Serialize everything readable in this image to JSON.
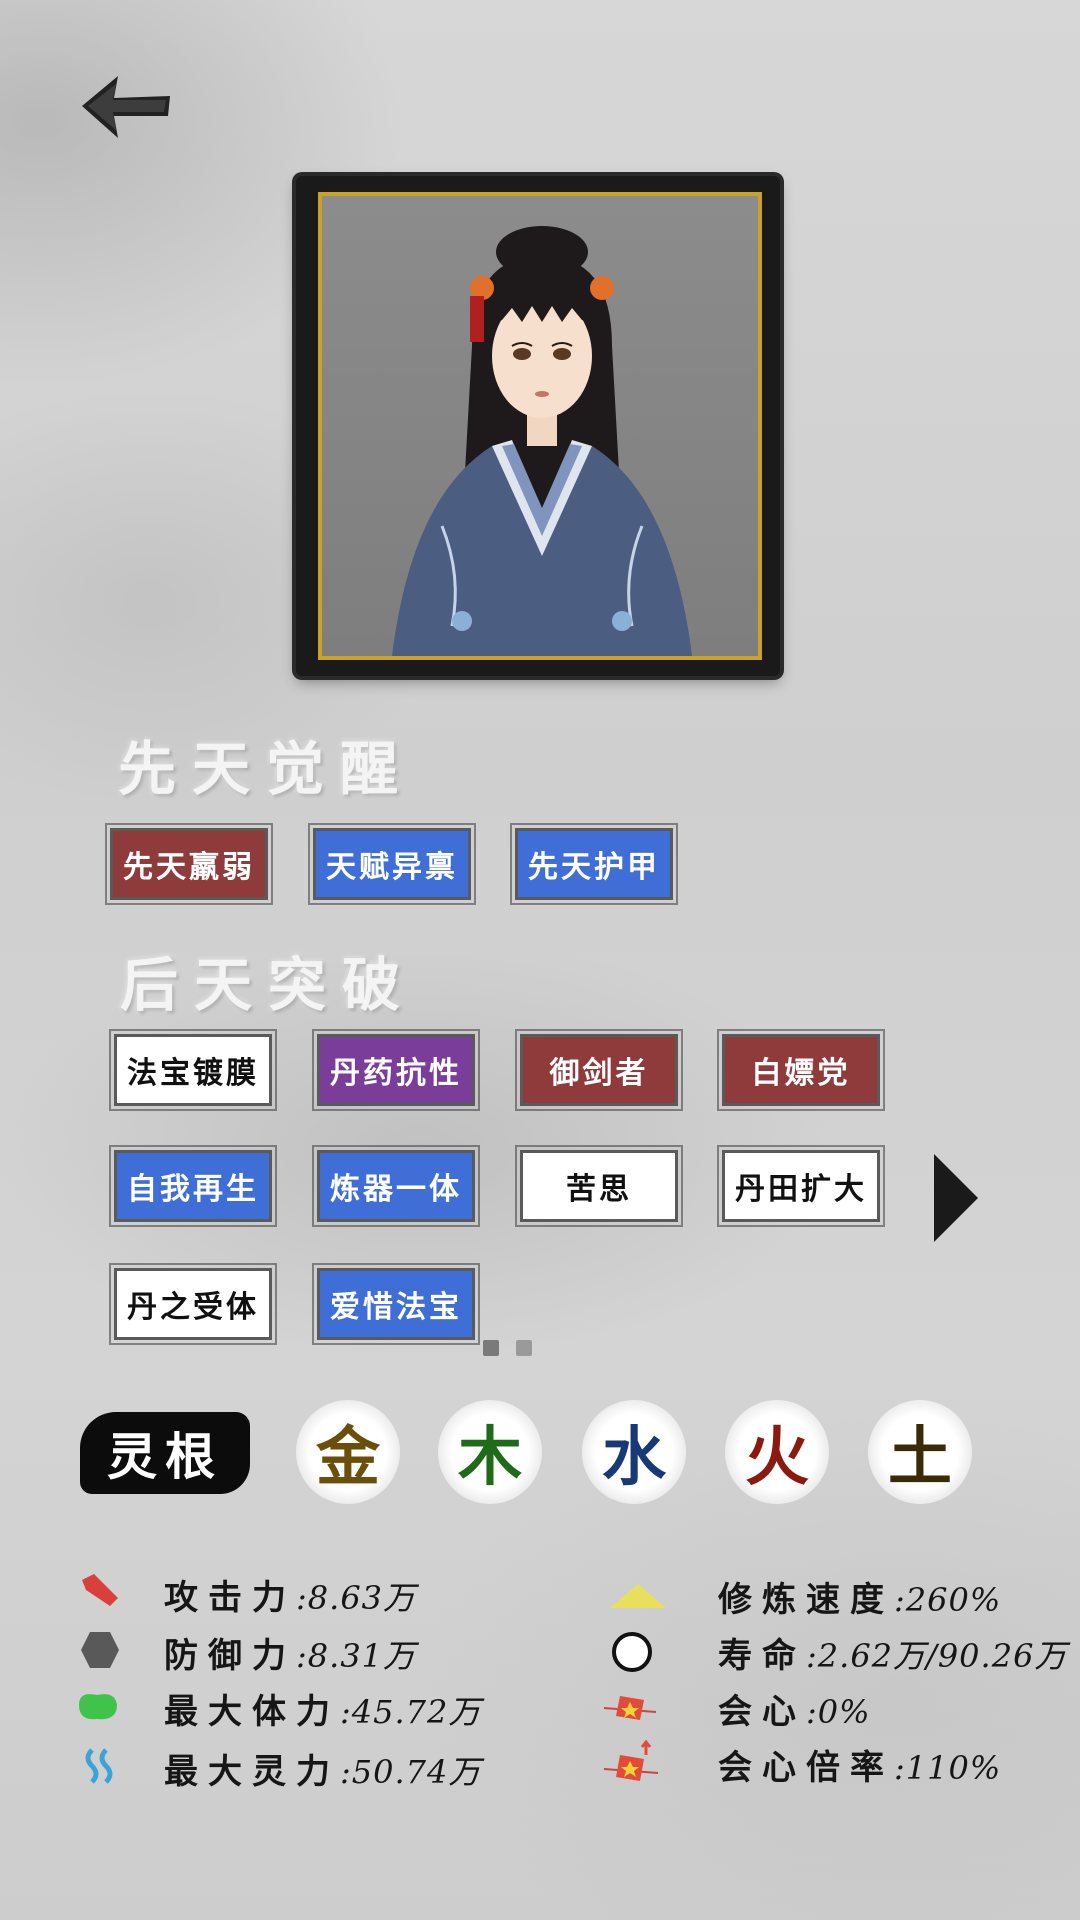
{
  "innate": {
    "title": "先天觉醒",
    "traits": [
      {
        "label": "先天羸弱",
        "color": "red"
      },
      {
        "label": "天赋异禀",
        "color": "blue"
      },
      {
        "label": "先天护甲",
        "color": "blue"
      }
    ]
  },
  "acquired": {
    "title": "后天突破",
    "traits": [
      {
        "label": "法宝镀膜",
        "color": "white"
      },
      {
        "label": "丹药抗性",
        "color": "purple"
      },
      {
        "label": "御剑者",
        "color": "red"
      },
      {
        "label": "白嫖党",
        "color": "red"
      },
      {
        "label": "自我再生",
        "color": "blue"
      },
      {
        "label": "炼器一体",
        "color": "blue"
      },
      {
        "label": "苦思",
        "color": "white"
      },
      {
        "label": "丹田扩大",
        "color": "white"
      },
      {
        "label": "丹之受体",
        "color": "white"
      },
      {
        "label": "爱惜法宝",
        "color": "blue"
      }
    ],
    "page_current": 1,
    "page_total": 2
  },
  "spirit_root": {
    "label": "灵根",
    "elements": [
      {
        "char": "金",
        "color": "#6b4e0a"
      },
      {
        "char": "木",
        "color": "#1f6b1a"
      },
      {
        "char": "水",
        "color": "#163a78"
      },
      {
        "char": "火",
        "color": "#8a1a10"
      },
      {
        "char": "土",
        "color": "#3b2a08"
      }
    ]
  },
  "stats_left": [
    {
      "icon": "attack-icon",
      "label": "攻击力",
      "value": ":8.63万"
    },
    {
      "icon": "defense-icon",
      "label": "防御力",
      "value": ":8.31万"
    },
    {
      "icon": "health-icon",
      "label": "最大体力",
      "value": ":45.72万"
    },
    {
      "icon": "spirit-icon",
      "label": "最大灵力",
      "value": ":50.74万"
    }
  ],
  "stats_right": [
    {
      "icon": "cultivation-speed-icon",
      "label": "修炼速度",
      "value": ":260%"
    },
    {
      "icon": "lifespan-icon",
      "label": "寿命",
      "value": ":2.62万/90.26万"
    },
    {
      "icon": "crit-icon",
      "label": "会心",
      "value": ":0%"
    },
    {
      "icon": "crit-multiplier-icon",
      "label": "会心倍率",
      "value": ":110%"
    }
  ]
}
